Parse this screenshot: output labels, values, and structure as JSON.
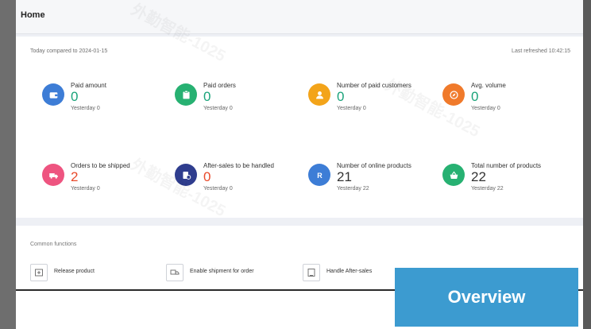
{
  "page": {
    "title": "Home"
  },
  "stats": {
    "today_label": "Today compared to 2024-01-15",
    "refresh_label": "Last refreshed 10:42:15",
    "items": [
      {
        "label": "Paid amount",
        "value": "0",
        "yesterday": "Yesterday 0",
        "icon": "wallet-icon",
        "color": "#3d7dd6",
        "value_color": "green"
      },
      {
        "label": "Paid orders",
        "value": "0",
        "yesterday": "Yesterday 0",
        "icon": "clipboard-icon",
        "color": "#27b172",
        "value_color": "green"
      },
      {
        "label": "Number of paid customers",
        "value": "0",
        "yesterday": "Yesterday 0",
        "icon": "user-icon",
        "color": "#f3a41a",
        "value_color": "green"
      },
      {
        "label": "Avg. volume",
        "value": "0",
        "yesterday": "Yesterday 0",
        "icon": "compass-icon",
        "color": "#f07a2b",
        "value_color": "green"
      },
      {
        "label": "Orders to be shipped",
        "value": "2",
        "yesterday": "Yesterday 0",
        "icon": "truck-icon",
        "color": "#ee5480",
        "value_color": "red"
      },
      {
        "label": "After-sales to be handled",
        "value": "0",
        "yesterday": "Yesterday 0",
        "icon": "refund-icon",
        "color": "#2f3d8e",
        "value_color": "red"
      },
      {
        "label": "Number of online products",
        "value": "21",
        "yesterday": "Yesterday 22",
        "icon": "product-icon",
        "color": "#3d7dd6",
        "value_color": "dark"
      },
      {
        "label": "Total number of products",
        "value": "22",
        "yesterday": "Yesterday 22",
        "icon": "basket-icon",
        "color": "#27b172",
        "value_color": "dark"
      }
    ]
  },
  "common_functions": {
    "title": "Common functions",
    "shortcuts": [
      {
        "label": "Release product",
        "icon": "release-icon"
      },
      {
        "label": "Enable shipment for order",
        "icon": "shipment-icon"
      },
      {
        "label": "Handle After-sales",
        "icon": "aftersales-icon"
      }
    ]
  },
  "watermark": {
    "text": "外勤智能-1025"
  },
  "overview_button": {
    "label": "Overview"
  }
}
